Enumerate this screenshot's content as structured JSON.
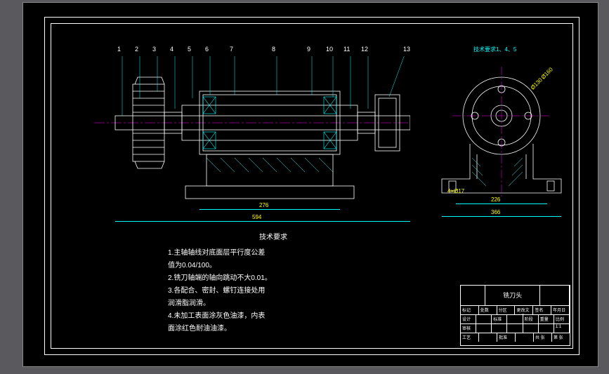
{
  "drawing": {
    "tech_title": "技术要求",
    "notes": [
      "1.主轴轴线对底面层平行度公差",
      "  值为0.04/100。",
      "2.铣刀轴端的轴向跳动不大0.01。",
      "3.各配合、密封、螺钉连接处用",
      "  润滑脂润滑。",
      "4.未加工表面涂灰色油漆，内表",
      "  面涂红色耐油油漆。"
    ],
    "top_note": "技术要求1、4、5",
    "dims": {
      "d1": "276",
      "d2": "594",
      "d3": "366",
      "d4": "226",
      "d5": "4×Ø17",
      "d6": "Ø160",
      "d7": "Ø130"
    },
    "callouts": [
      "1",
      "2",
      "3",
      "4",
      "5",
      "6",
      "7",
      "8",
      "9",
      "10",
      "11",
      "12",
      "13"
    ]
  },
  "title_block": {
    "part_name": "铣刀头",
    "r1c1": "标记",
    "r1c2": "处数",
    "r1c3": "分区",
    "r1c4": "更改文件号",
    "r1c5": "签名",
    "r1c6": "年月日",
    "r2c1": "设计",
    "r2c2": "",
    "r2c3": "标准化",
    "r2c4": "",
    "r2c5": "阶段标记",
    "r2c6": "重量",
    "r2c7": "比例",
    "r3c1": "审核",
    "r3c2": "",
    "r3c3": "",
    "r3c4": "",
    "r3c5": "",
    "r3c6": "",
    "r3c7": "1:1",
    "r4c1": "工艺",
    "r4c2": "",
    "r4c3": "批准",
    "r4c4": "",
    "r4c5": "共 张",
    "r4c6": "第 张"
  }
}
